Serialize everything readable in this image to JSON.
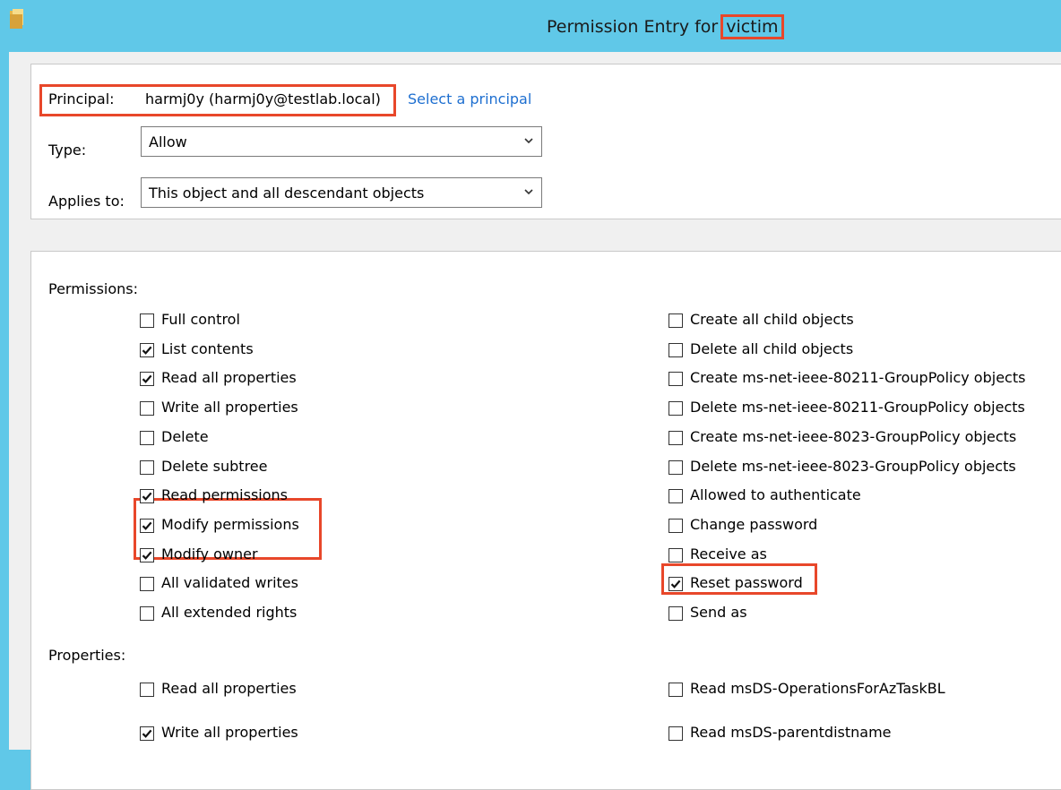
{
  "window": {
    "title": "Permission Entry for ",
    "title_highlight": "victim"
  },
  "principal": {
    "label": "Principal:",
    "value": "harmj0y (harmj0y@testlab.local)",
    "select_link": "Select a principal"
  },
  "type_field": {
    "label": "Type:",
    "value": "Allow"
  },
  "applies_field": {
    "label": "Applies to:",
    "value": "This object and all descendant objects"
  },
  "permissions": {
    "heading": "Permissions:",
    "left": [
      {
        "label": "Full control",
        "checked": false
      },
      {
        "label": "List contents",
        "checked": true
      },
      {
        "label": "Read all properties",
        "checked": true
      },
      {
        "label": "Write all properties",
        "checked": false
      },
      {
        "label": "Delete",
        "checked": false
      },
      {
        "label": "Delete subtree",
        "checked": false
      },
      {
        "label": "Read permissions",
        "checked": true
      },
      {
        "label": "Modify permissions",
        "checked": true
      },
      {
        "label": "Modify owner",
        "checked": true
      },
      {
        "label": "All validated writes",
        "checked": false
      },
      {
        "label": "All extended rights",
        "checked": false
      }
    ],
    "right": [
      {
        "label": "Create all child objects",
        "checked": false
      },
      {
        "label": "Delete all child objects",
        "checked": false
      },
      {
        "label": "Create ms-net-ieee-80211-GroupPolicy objects",
        "checked": false
      },
      {
        "label": "Delete ms-net-ieee-80211-GroupPolicy objects",
        "checked": false
      },
      {
        "label": "Create ms-net-ieee-8023-GroupPolicy objects",
        "checked": false
      },
      {
        "label": "Delete ms-net-ieee-8023-GroupPolicy objects",
        "checked": false
      },
      {
        "label": "Allowed to authenticate",
        "checked": false
      },
      {
        "label": "Change password",
        "checked": false
      },
      {
        "label": "Receive as",
        "checked": false
      },
      {
        "label": "Reset password",
        "checked": true
      },
      {
        "label": "Send as",
        "checked": false
      }
    ]
  },
  "properties": {
    "heading": "Properties:",
    "left": [
      {
        "label": "Read all properties",
        "checked": false
      },
      {
        "label": "Write all properties",
        "checked": true
      }
    ],
    "right": [
      {
        "label": "Read msDS-OperationsForAzTaskBL",
        "checked": false
      },
      {
        "label": "Read msDS-parentdistname",
        "checked": false
      }
    ]
  },
  "colors": {
    "titlebar": "#60c8e8",
    "highlight": "#e8472a",
    "link": "#1e6fd0",
    "dialog_bg": "#f0f0f0"
  }
}
